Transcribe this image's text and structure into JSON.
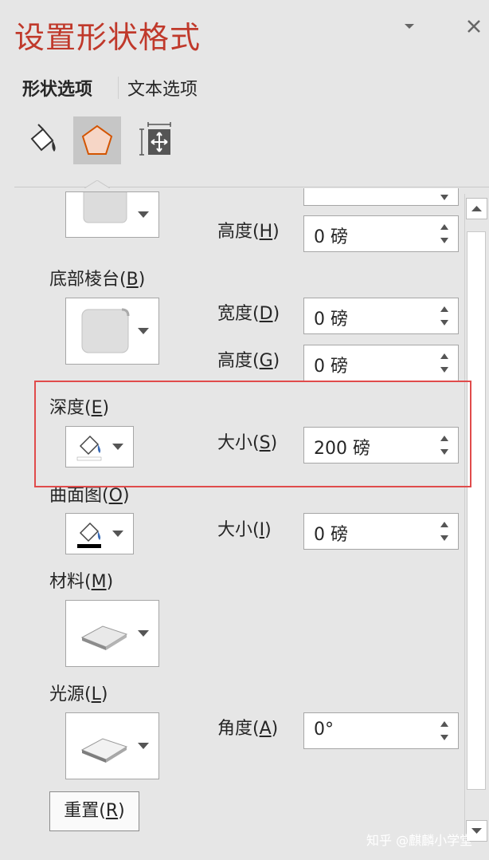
{
  "header": {
    "title": "设置形状格式"
  },
  "tabs": {
    "shape": "形状选项",
    "text": "文本选项"
  },
  "sections": {
    "top_bevel": {
      "height_label": "高度",
      "height_key": "H",
      "height_value": "0 磅"
    },
    "bottom_bevel": {
      "label": "底部棱台",
      "key": "B",
      "width_label": "宽度",
      "width_key": "D",
      "width_value": "0 磅",
      "height_label": "高度",
      "height_key": "G",
      "height_value": "0 磅"
    },
    "depth": {
      "label": "深度",
      "key": "E",
      "size_label": "大小",
      "size_key": "S",
      "size_value": "200 磅"
    },
    "contour": {
      "label": "曲面图",
      "key": "O",
      "size_label": "大小",
      "size_key": "I",
      "size_value": "0 磅"
    },
    "material": {
      "label": "材料",
      "key": "M"
    },
    "lighting": {
      "label": "光源",
      "key": "L",
      "angle_label": "角度",
      "angle_key": "A",
      "angle_value": "0°"
    }
  },
  "reset": {
    "label": "重置",
    "key": "R"
  },
  "watermark": "知乎 @麒麟小学堂",
  "colors": {
    "title": "#c0392b",
    "highlight": "#e04b4b",
    "panel": "#e6e6e6"
  },
  "icons": [
    "dropdown-arrow-icon",
    "close-icon",
    "fill-line-icon",
    "effects-pentagon-icon",
    "size-properties-icon",
    "paint-bucket-icon"
  ]
}
